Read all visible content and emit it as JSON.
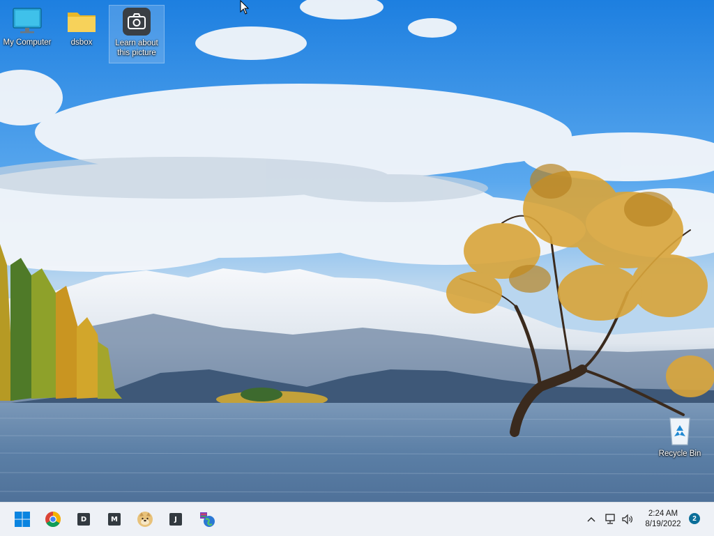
{
  "desktop": {
    "icons": [
      {
        "label": "My Computer",
        "icon": "monitor-icon"
      },
      {
        "label": "dsbox",
        "icon": "folder-icon"
      },
      {
        "label": "Learn about this picture",
        "icon": "camera-icon"
      },
      {
        "label": "Recycle Bin",
        "icon": "recycle-bin-icon"
      }
    ]
  },
  "taskbar": {
    "apps": [
      {
        "name": "start",
        "icon": "windows-logo-icon"
      },
      {
        "name": "chrome",
        "icon": "chrome-icon"
      },
      {
        "name": "app-d",
        "letter": "D"
      },
      {
        "name": "app-m",
        "letter": "M"
      },
      {
        "name": "doge",
        "icon": "doge-icon"
      },
      {
        "name": "app-j",
        "letter": "J"
      },
      {
        "name": "globe-app",
        "icon": "globe-icon"
      }
    ],
    "tray": {
      "time": "2:24 AM",
      "date": "8/19/2022",
      "notifications": "2"
    }
  },
  "colors": {
    "sky": "#2f8fe8",
    "lake": "#5f88b4",
    "taskbar": "#eef1f6",
    "accent": "#0078d4"
  }
}
